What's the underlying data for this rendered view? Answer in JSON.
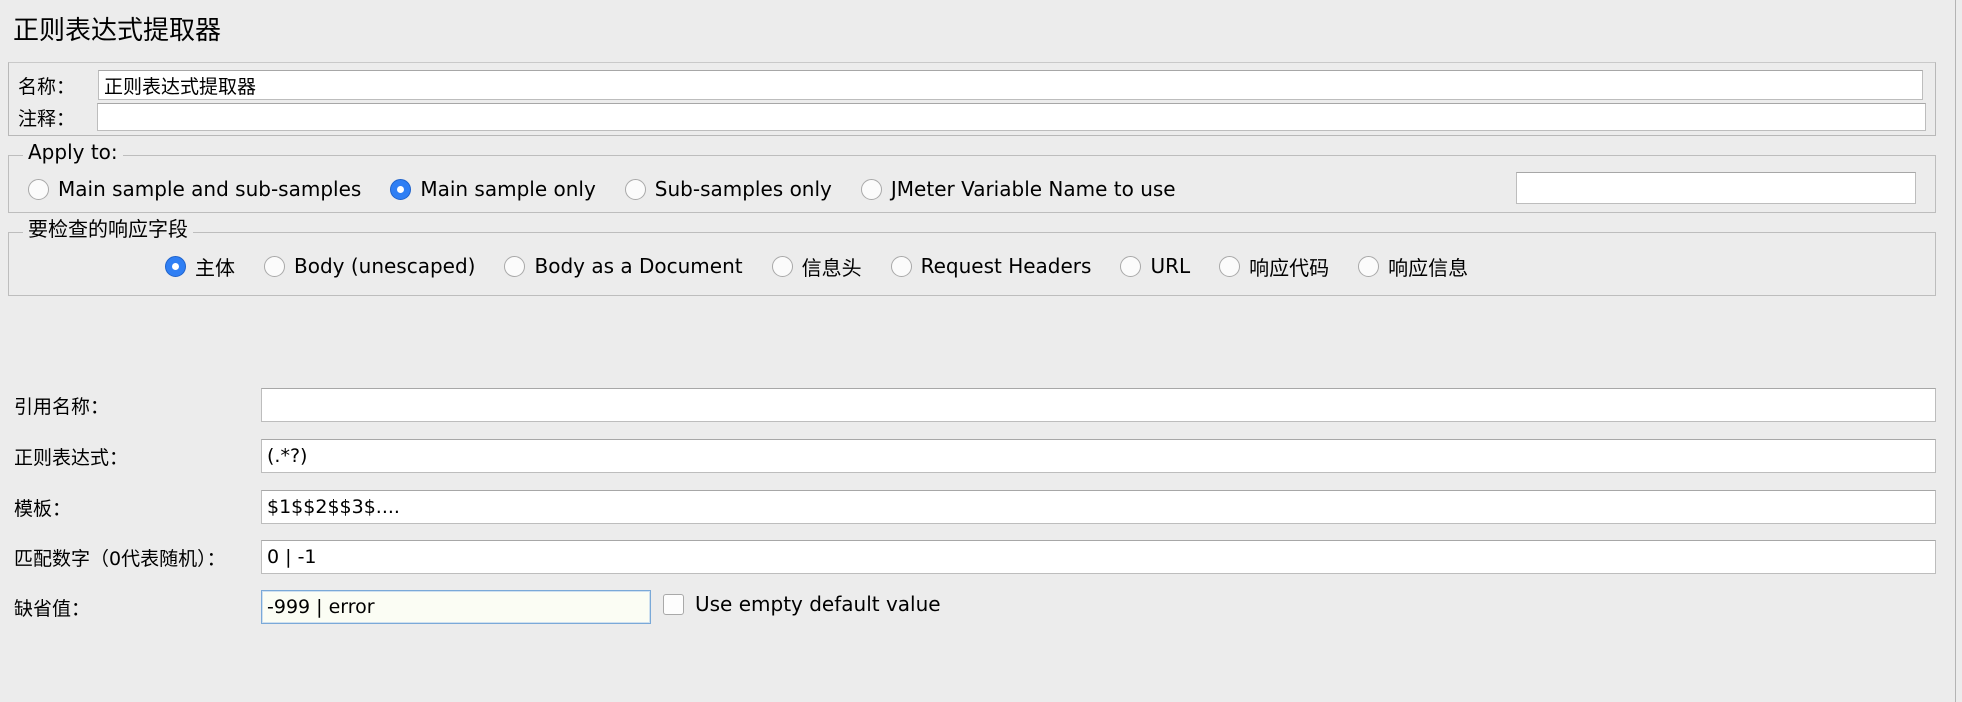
{
  "page": {
    "title": "正则表达式提取器"
  },
  "header_fields": {
    "name_label": "名称：",
    "name_value": "正则表达式提取器",
    "comment_label": "注释：",
    "comment_value": ""
  },
  "apply_to": {
    "group_title": "Apply to:",
    "options": [
      {
        "label": "Main sample and sub-samples",
        "selected": false
      },
      {
        "label": "Main sample only",
        "selected": true
      },
      {
        "label": "Sub-samples only",
        "selected": false
      },
      {
        "label": "JMeter Variable Name to use",
        "selected": false
      }
    ],
    "variable_value": "",
    "variable_placeholder": ""
  },
  "response_field": {
    "group_title": "要检查的响应字段",
    "options": [
      {
        "label": "主体",
        "selected": true
      },
      {
        "label": "Body (unescaped)",
        "selected": false
      },
      {
        "label": "Body as a Document",
        "selected": false
      },
      {
        "label": "信息头",
        "selected": false
      },
      {
        "label": "Request Headers",
        "selected": false
      },
      {
        "label": "URL",
        "selected": false
      },
      {
        "label": "响应代码",
        "selected": false
      },
      {
        "label": "响应信息",
        "selected": false
      }
    ]
  },
  "fields": {
    "reference_name_label": "引用名称：",
    "reference_name_value": "",
    "regex_label": "正则表达式：",
    "regex_value": "(.*?)",
    "template_label": "模板：",
    "template_value": "$1$$2$$3$....",
    "match_no_label": "匹配数字（0代表随机）：",
    "match_no_value": "0  |  -1",
    "default_label": "缺省值：",
    "default_value": "-999  |  error",
    "use_empty_default_label": "Use empty default value",
    "use_empty_default_checked": false
  },
  "colors": {
    "background": "#ececec",
    "field_background": "#ffffff",
    "radio_selected": "#2f7ff4",
    "focus_border": "#7aa9d8",
    "border": "#bdbdbd"
  }
}
